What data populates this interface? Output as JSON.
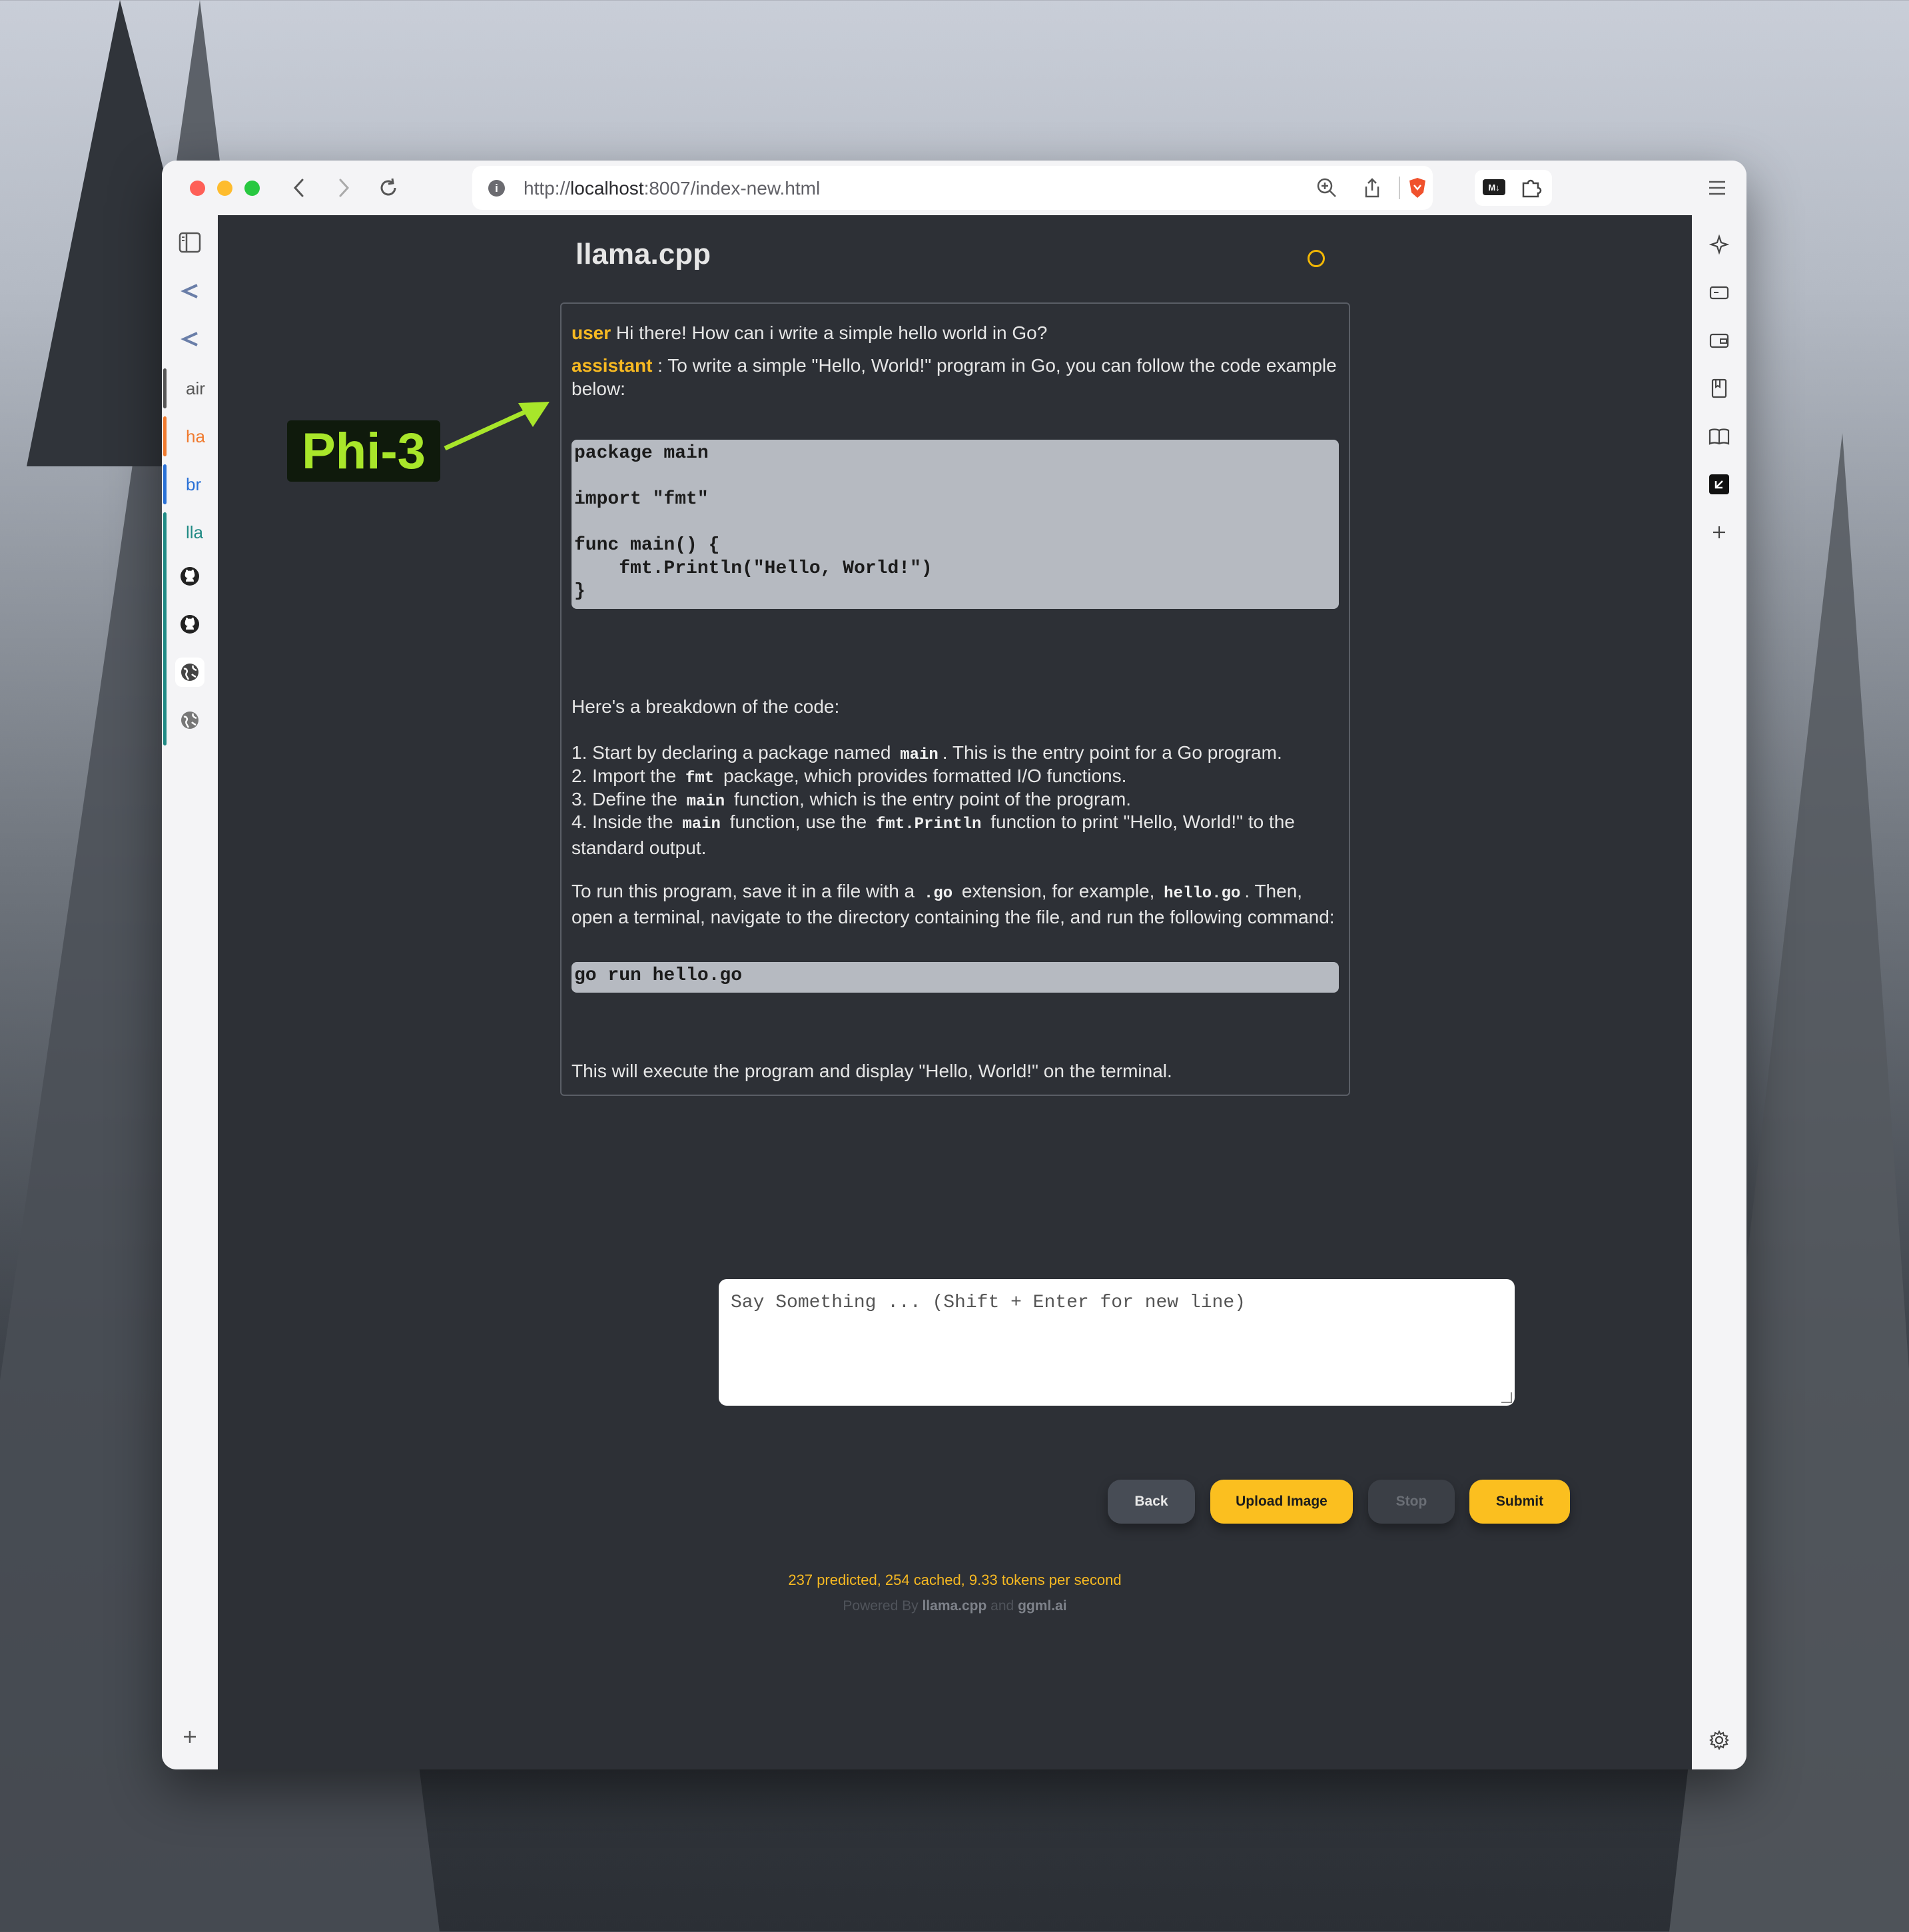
{
  "browser": {
    "url_prefix": "http://",
    "url_host": "localhost",
    "url_rest": ":8007/index-new.html",
    "tabs": [
      {
        "label": "air",
        "color": "#555555"
      },
      {
        "label": "ha",
        "color": "#f07a2e"
      },
      {
        "label": "br",
        "color": "#2970d6"
      },
      {
        "label": "lla",
        "color": "#1f8a84"
      }
    ]
  },
  "app": {
    "title": "llama.cpp",
    "messages": [
      {
        "role": "user",
        "text": " Hi there! How can i write a simple hello world in Go?"
      },
      {
        "role": "assistant",
        "text": " : To write a simple \"Hello, World!\" program in Go, you can follow the code example below:"
      }
    ],
    "code1": "package main\n\nimport \"fmt\"\n\nfunc main() {\n    fmt.Println(\"Hello, World!\")\n}",
    "breakdown_intro": "Here's a breakdown of the code:",
    "steps": [
      {
        "a": "1. Start by declaring a package named ",
        "code": "main",
        "b": ". This is the entry point for a Go program."
      },
      {
        "a": "2. Import the ",
        "code": "fmt",
        "b": " package, which provides formatted I/O functions."
      },
      {
        "a": "3. Define the ",
        "code": "main",
        "b": " function, which is the entry point of the program."
      },
      {
        "a": "4. Inside the ",
        "code": "main",
        "b": " function, use the ",
        "code2": "fmt.Println",
        "c": " function to print \"Hello, World!\" to the standard output."
      }
    ],
    "run_text": {
      "a": "To run this program, save it in a file with a ",
      "code": ".go",
      "b": " extension, for example, ",
      "code2": "hello.go",
      "c": ". Then, open a terminal, navigate to the directory containing the file, and run the following command:"
    },
    "code2": "go run hello.go",
    "closing": "This will execute the program and display \"Hello, World!\" on the terminal.",
    "input_placeholder": "Say Something ... (Shift + Enter for new line)",
    "buttons": {
      "back": "Back",
      "upload": "Upload Image",
      "stop": "Stop",
      "submit": "Submit"
    },
    "stats": "237 predicted, 254 cached, 9.33 tokens per second",
    "powered_prefix": "Powered By ",
    "powered_llama": "llama.cpp",
    "powered_and": " and ",
    "powered_ggml": "ggml.ai"
  },
  "annotation": {
    "label": "Phi-3",
    "color": "#a8e62a"
  }
}
